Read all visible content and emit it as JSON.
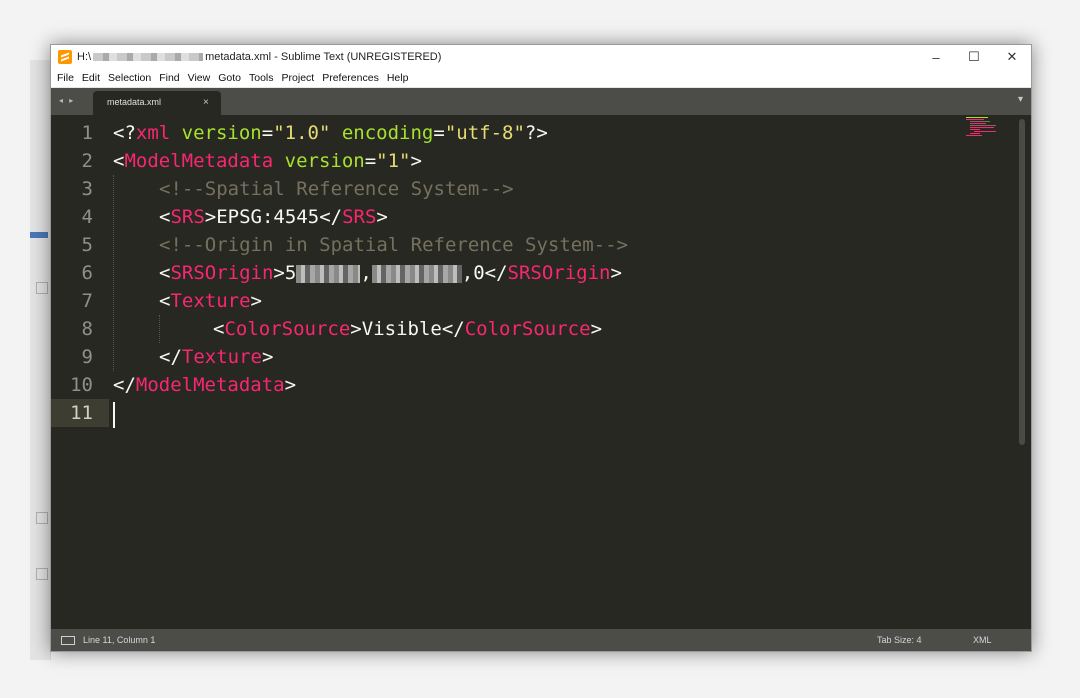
{
  "window": {
    "title_prefix": "H:\\",
    "title_suffix": "metadata.xml - Sublime Text (UNREGISTERED)",
    "minimize": "–",
    "maximize": "☐",
    "close": "✕"
  },
  "menu": [
    "File",
    "Edit",
    "Selection",
    "Find",
    "View",
    "Goto",
    "Tools",
    "Project",
    "Preferences",
    "Help"
  ],
  "tabs": {
    "nav": "◂ ▸",
    "active": "metadata.xml",
    "close": "×",
    "dropdown": "▾"
  },
  "editor": {
    "line_numbers": [
      "1",
      "2",
      "3",
      "4",
      "5",
      "6",
      "7",
      "8",
      "9",
      "10",
      "11"
    ],
    "active_line": 11,
    "lines": {
      "l1": {
        "open": "<?",
        "name": "xml",
        "a1": "version",
        "eq1": "=",
        "v1": "\"1.0\"",
        "a2": "encoding",
        "eq2": "=",
        "v2": "\"utf-8\"",
        "close": "?>"
      },
      "l2": {
        "open": "<",
        "name": "ModelMetadata",
        "a1": "version",
        "eq1": "=",
        "v1": "\"1\"",
        "close": ">"
      },
      "l3": {
        "text": "<!--Spatial Reference System-->"
      },
      "l4": {
        "o": "<",
        "n": "SRS",
        "c": ">",
        "val": "EPSG:4545",
        "o2": "</",
        "n2": "SRS",
        "c2": ">"
      },
      "l5": {
        "text": "<!--Origin in Spatial Reference System-->"
      },
      "l6": {
        "o": "<",
        "n": "SRSOrigin",
        "c": ">",
        "p1": "5",
        "p2": ",",
        "p3": ",0",
        "o2": "</",
        "n2": "SRSOrigin",
        "c2": ">"
      },
      "l7": {
        "o": "<",
        "n": "Texture",
        "c": ">"
      },
      "l8": {
        "o": "<",
        "n": "ColorSource",
        "c": ">",
        "val": "Visible",
        "o2": "</",
        "n2": "ColorSource",
        "c2": ">"
      },
      "l9": {
        "o": "</",
        "n": "Texture",
        "c": ">"
      },
      "l10": {
        "o": "</",
        "n": "ModelMetadata",
        "c": ">"
      }
    }
  },
  "status": {
    "position": "Line 11, Column 1",
    "tab_size": "Tab Size: 4",
    "syntax": "XML"
  },
  "colors": {
    "background": "#272822",
    "tag": "#f92672",
    "attribute": "#a6e22e",
    "string": "#e6db74",
    "comment": "#75715e",
    "text": "#f8f8f2"
  }
}
